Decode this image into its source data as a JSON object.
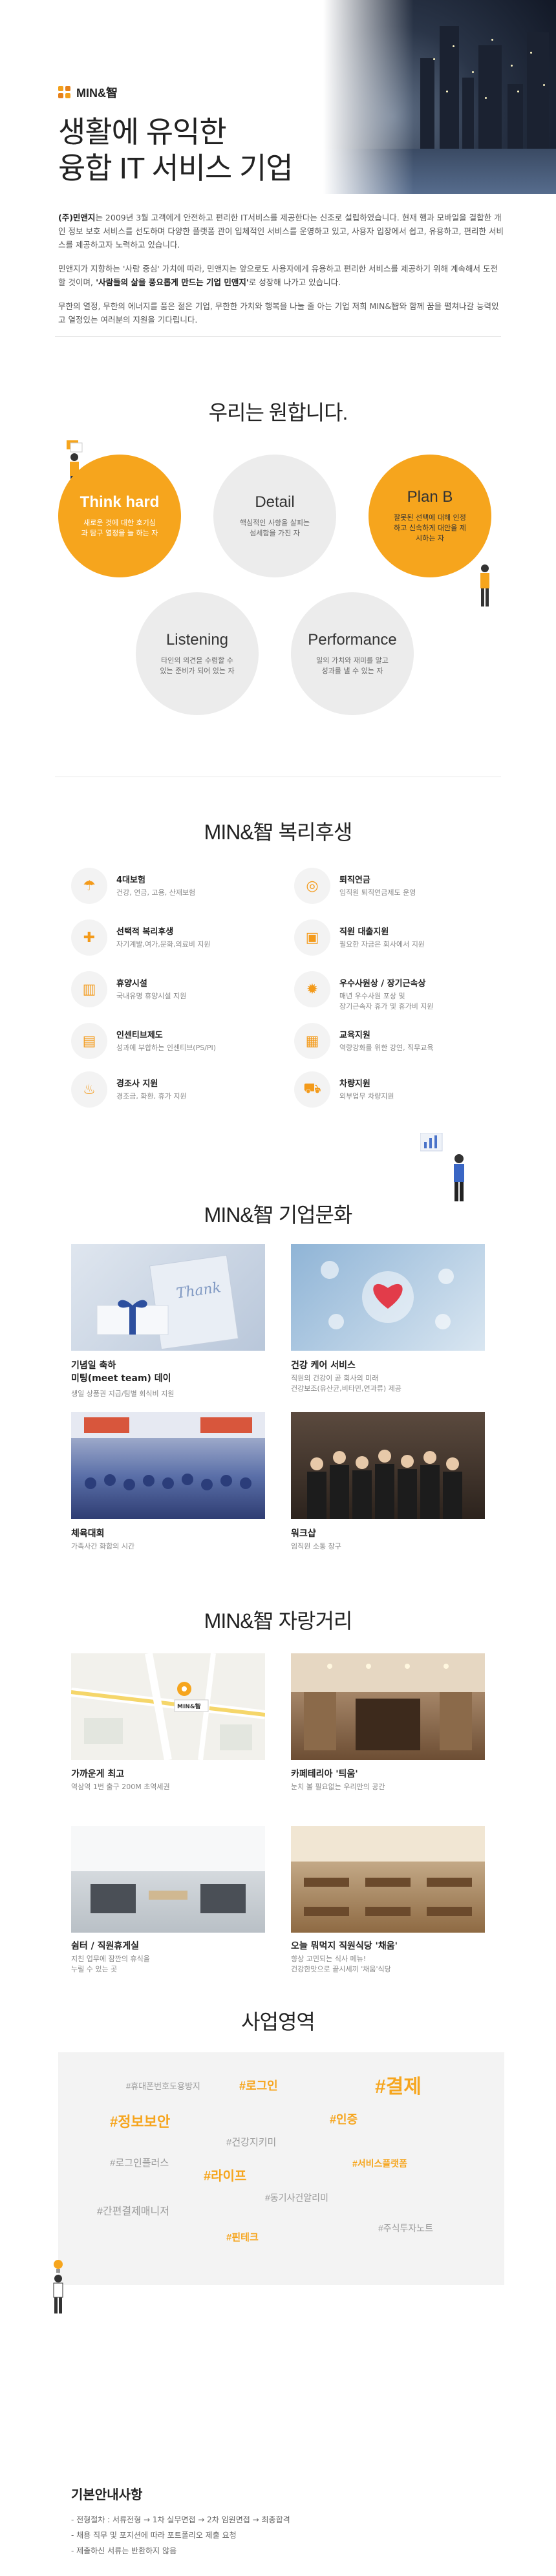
{
  "brand": {
    "logo_text": "MIN&智",
    "accent": "#f6a51d"
  },
  "hero": {
    "title_line1": "생활에 유익한",
    "title_line2": "융합 IT 서비스 기업",
    "intro_p1_bold": "(주)민앤지",
    "intro_p1": "는 2009년 3월 고객에게 안전하고 편리한 IT서비스를 제공한다는 신조로 설립하였습니다. 현재 햄과 모바일을 결합한 개인 정보 보호 서비스를 선도하며 다양한 플랫폼 관이 입체적인 서비스를 운영하고 있고, 사용자 입장에서 쉽고, 유용하고, 편리한 서비스를 제공하고자 노력하고 있습니다.",
    "intro_p2_a": "민앤지가 지향하는 '사람 중심' 가치에 따라, 민앤지는 앞으로도 사용자에게 유용하고 편리한 서비스를 제공하기 위해 계속해서 도전할 것이며,",
    "intro_p2_bold": " '사람들의 삶을 풍요롭게 만드는 기업 민앤지'",
    "intro_p2_b": "로 성장해 나가고 있습니다.",
    "intro_p3": "무한의 열정, 무한의 에너지를 품은 젊은 기업, 무한한 가치와 행복을 나눌 줄 아는 기업 저희 MIN&智와 함께 꿈을 펼쳐나갈 능력있고 열정있는 여러분의 지원을 기다립니다."
  },
  "values": {
    "title": "우리는 원합니다.",
    "items": [
      {
        "title": "Think hard",
        "desc": "새로운 것에 대한 호기심과 탐구 열정을 늘 하는 자"
      },
      {
        "title": "Detail",
        "desc": "핵심적인 사항을 살피는 섬세함을 가진 자"
      },
      {
        "title": "Plan B",
        "desc": "잘못된 선택에 대해 인정하고 신속하게 대안을 제시하는 자"
      },
      {
        "title": "Listening",
        "desc": "타인의 의견을 수렴할 수 있는 준비가 되어 있는 자"
      },
      {
        "title": "Performance",
        "desc": "일의 가치와 재미를 알고 성과를 낼 수 있는 자"
      }
    ]
  },
  "welfare": {
    "title": "MIN&智 복리후생",
    "items": [
      {
        "title": "4대보험",
        "desc": "건강, 연금, 고용, 산재보험",
        "icon": "umbrella-icon"
      },
      {
        "title": "퇴직연금",
        "desc": "임직원 퇴직연금제도 운영",
        "icon": "coin-icon"
      },
      {
        "title": "선택적 복리후생",
        "desc": "자기계발,여가,문화,의료비 지원",
        "icon": "gift-icon"
      },
      {
        "title": "직원 대출지원",
        "desc": "필요한 자금은 회사에서 지원",
        "icon": "wallet-icon"
      },
      {
        "title": "휴양시설",
        "desc": "국내유명 휴양시설 지원",
        "icon": "building-icon"
      },
      {
        "title": "우수사원상 / 장기근속상",
        "desc": "매년 우수사원 포상 및\n장기근속자 휴가 및 휴가비 지원",
        "icon": "medal-icon"
      },
      {
        "title": "인센티브제도",
        "desc": "성과에 부합하는 인센티브(PS/PI)",
        "icon": "chart-icon"
      },
      {
        "title": "교육지원",
        "desc": "역량강화를 위한 강연, 직무교육",
        "icon": "board-icon"
      },
      {
        "title": "경조사 지원",
        "desc": "경조금, 화환, 휴가 지원",
        "icon": "cake-icon"
      },
      {
        "title": "차량지원",
        "desc": "외부업무 차량지원",
        "icon": "car-icon"
      }
    ]
  },
  "culture": {
    "title": "MIN&智 기업문화",
    "items": [
      {
        "title": "기념일 축하\n미팅(meet team) 데이",
        "desc": "생일 상품권 지급/팀별 회식비 지원"
      },
      {
        "title": "건강 케어 서비스",
        "desc": "직원의 건강이 곧 회사의 미래\n건강보조(유산균,비타민,연과류) 제공"
      },
      {
        "title": "체육대회",
        "desc": "가족사간 화합의 시간"
      },
      {
        "title": "워크샵",
        "desc": "임직원 소통 창구"
      }
    ]
  },
  "attractions": {
    "title": "MIN&智 자랑거리",
    "map_label": "MIN&智",
    "items": [
      {
        "title": "가까운게 최고",
        "desc": "역삼역 1번 출구 200M 초역세권"
      },
      {
        "title": "카페테리아 '틔움'",
        "desc": "눈치 볼 필요없는 우리만의 공간"
      },
      {
        "title": "쉼터 / 직원휴게실",
        "desc": "지친 업무에 잠깐의 휴식을\n누릴 수 있는 곳"
      },
      {
        "title": "오늘 뭐먹지 직원식당 '채움'",
        "desc": "향상 고민되는 식사 메뉴!\n건강한맛으로 끝시세끼 '채움'식당"
      }
    ]
  },
  "business": {
    "title": "사업영역",
    "tags": [
      {
        "text": "#휴대폰번호도용방지",
        "tone": "gray",
        "size": 13
      },
      {
        "text": "#로그인",
        "tone": "orange",
        "size": 18
      },
      {
        "text": "#결제",
        "tone": "orange",
        "size": 30
      },
      {
        "text": "#정보보안",
        "tone": "orange",
        "size": 22
      },
      {
        "text": "#인증",
        "tone": "orange",
        "size": 18
      },
      {
        "text": "#건강지키미",
        "tone": "gray",
        "size": 15
      },
      {
        "text": "#로그인플러스",
        "tone": "gray",
        "size": 15
      },
      {
        "text": "#라이프",
        "tone": "orange",
        "size": 20
      },
      {
        "text": "#서비스플랫폼",
        "tone": "orange",
        "size": 14
      },
      {
        "text": "#동기사건알리미",
        "tone": "gray",
        "size": 14
      },
      {
        "text": "#간편결제매니저",
        "tone": "gray",
        "size": 16
      },
      {
        "text": "#핀테크",
        "tone": "orange",
        "size": 15
      },
      {
        "text": "#주식투자노트",
        "tone": "gray",
        "size": 14
      }
    ]
  },
  "guide": {
    "title": "기본안내사항",
    "lines": [
      "- 전형절차 : 서류전형 → 1차 실무면접 → 2차 임원면접 → 최종합격",
      "- 채용 직무 및 포지션에 따라 포트폴리오 제출 요청",
      "- 제출하신 서류는 반환하지 않음"
    ]
  }
}
